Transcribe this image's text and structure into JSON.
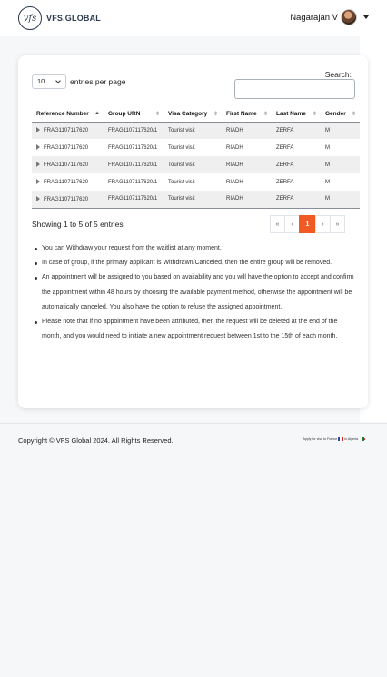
{
  "header": {
    "logo_mark": "vfs",
    "logo_text": "VFS.GLOBAL",
    "user_name": "Nagarajan V"
  },
  "table_controls": {
    "entries_value": "10",
    "entries_label": "entries per page",
    "search_label": "Search:",
    "search_value": ""
  },
  "table": {
    "columns": [
      "Reference Number",
      "Group URN",
      "Visa Category",
      "First Name",
      "Last Name",
      "Gender"
    ],
    "sorted_column": "Reference Number",
    "rows": [
      [
        "FRAG1107117620",
        "FRAG1107117620/1",
        "Tourist visit",
        "RIADH",
        "ZERFA",
        "M"
      ],
      [
        "FRAG1107117620",
        "FRAG1107117620/1",
        "Tourist visit",
        "RIADH",
        "ZERFA",
        "M"
      ],
      [
        "FRAG1107117620",
        "FRAG1107117620/1",
        "Tourist visit",
        "RIADH",
        "ZERFA",
        "M"
      ],
      [
        "FRAG1107117620",
        "FRAG1107117620/1",
        "Tourist visit",
        "RIADH",
        "ZERFA",
        "M"
      ],
      [
        "FRAG1107117620",
        "FRAG1107117620/1",
        "Tourist visit",
        "RIADH",
        "ZERFA",
        "M"
      ]
    ]
  },
  "table_info": "Showing 1 to 5 of 5 entries",
  "pagination": {
    "first": "«",
    "prev": "‹",
    "current": "1",
    "next": "›",
    "last": "»"
  },
  "notes": [
    "You can Withdraw your request from the waitlist at any moment.",
    "In case of group, if the primary applicant is Withdrawn/Canceled, then the entire group will be removed.",
    "An appointment will be assigned to you based on availability and you will have the option to accept and confirm the appointment within 48 hours by choosing the available payment method, otherwise the appointment will be automatically canceled. You also have the option to refuse the assigned appointment.",
    "Please note that if no appointment have been attributed, then the request will be deleted at the end of the month, and you would need to initiate a new appointment request between 1st to the 15th of each month."
  ],
  "footer": {
    "copyright": "Copyright © VFS Global 2024. All Rights Reserved.",
    "apply_prefix": "Apply for visa to France",
    "apply_suffix": "in Algeria"
  },
  "colors": {
    "accent": "#f15a22",
    "brand": "#2b3a4f"
  },
  "icons": {
    "sort": "sort-arrows-icon",
    "expand": "triangle-right-icon",
    "dropdown": "chevron-down-icon"
  }
}
